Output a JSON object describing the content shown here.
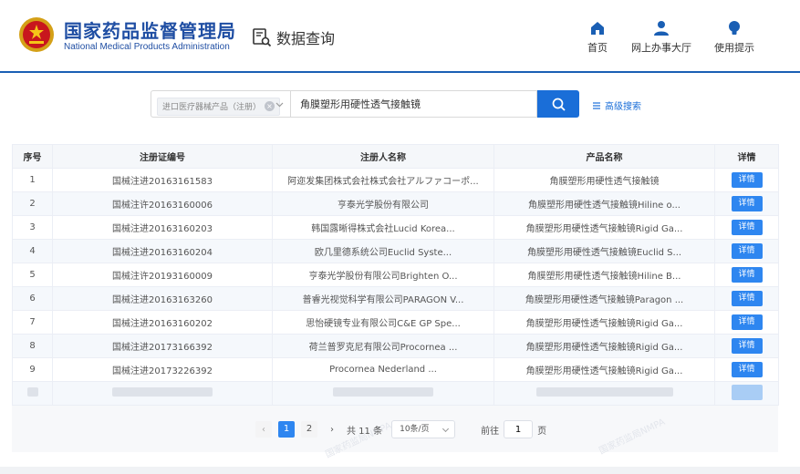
{
  "header": {
    "org_name_cn": "国家药品监督管理局",
    "org_name_en": "National Medical Products Administration",
    "module_label": "数据查询",
    "nav": [
      {
        "label": "首页",
        "icon": "home-icon"
      },
      {
        "label": "网上办事大厅",
        "icon": "user-icon"
      },
      {
        "label": "使用提示",
        "icon": "bulb-icon"
      }
    ],
    "accent_color": "#1a5fb4"
  },
  "search": {
    "type_tag": "进口医疗器械产品（注册）",
    "query": "角膜塑形用硬性透气接触镜",
    "advanced_label": "高级搜索"
  },
  "table": {
    "headers": [
      "序号",
      "注册证编号",
      "注册人名称",
      "产品名称",
      "详情"
    ],
    "detail_label": "详情",
    "rows": [
      {
        "no": "1",
        "cert": "国械注进20163161583",
        "registrant": "阿迩发集团株式会社株式会社アルファコーポ...",
        "product": "角膜塑形用硬性透气接触镜"
      },
      {
        "no": "2",
        "cert": "国械注许20163160006",
        "registrant": "亨泰光学股份有限公司",
        "product": "角膜塑形用硬性透气接触镜Hiline o..."
      },
      {
        "no": "3",
        "cert": "国械注进20163160203",
        "registrant": "韩国露晰得株式会社Lucid Korea...",
        "product": "角膜塑形用硬性透气接触镜Rigid Ga..."
      },
      {
        "no": "4",
        "cert": "国械注进20163160204",
        "registrant": "欧几里德系统公司Euclid Syste...",
        "product": "角膜塑形用硬性透气接触镜Euclid S..."
      },
      {
        "no": "5",
        "cert": "国械注许20193160009",
        "registrant": "亨泰光学股份有限公司Brighten O...",
        "product": "角膜塑形用硬性透气接触镜Hiline B..."
      },
      {
        "no": "6",
        "cert": "国械注进20163163260",
        "registrant": "普睿光视觉科学有限公司PARAGON V...",
        "product": "角膜塑形用硬性透气接触镜Paragon ..."
      },
      {
        "no": "7",
        "cert": "国械注进20163160202",
        "registrant": "思怡硬镜专业有限公司C&E GP Spe...",
        "product": "角膜塑形用硬性透气接触镜Rigid Ga..."
      },
      {
        "no": "8",
        "cert": "国械注进20173166392",
        "registrant": "荷兰普罗克尼有限公司Procornea ...",
        "product": "角膜塑形用硬性透气接触镜Rigid Ga..."
      },
      {
        "no": "9",
        "cert": "国械注进20173226392",
        "registrant": "Procornea Nederland ...",
        "product": "角膜塑形用硬性透气接触镜Rigid Ga..."
      }
    ]
  },
  "pagination": {
    "pages": [
      "1",
      "2"
    ],
    "current_page": "1",
    "total": "共 11 条",
    "page_size": "10条/页",
    "goto_label": "前往",
    "goto_value": "1",
    "page_unit": "页"
  }
}
